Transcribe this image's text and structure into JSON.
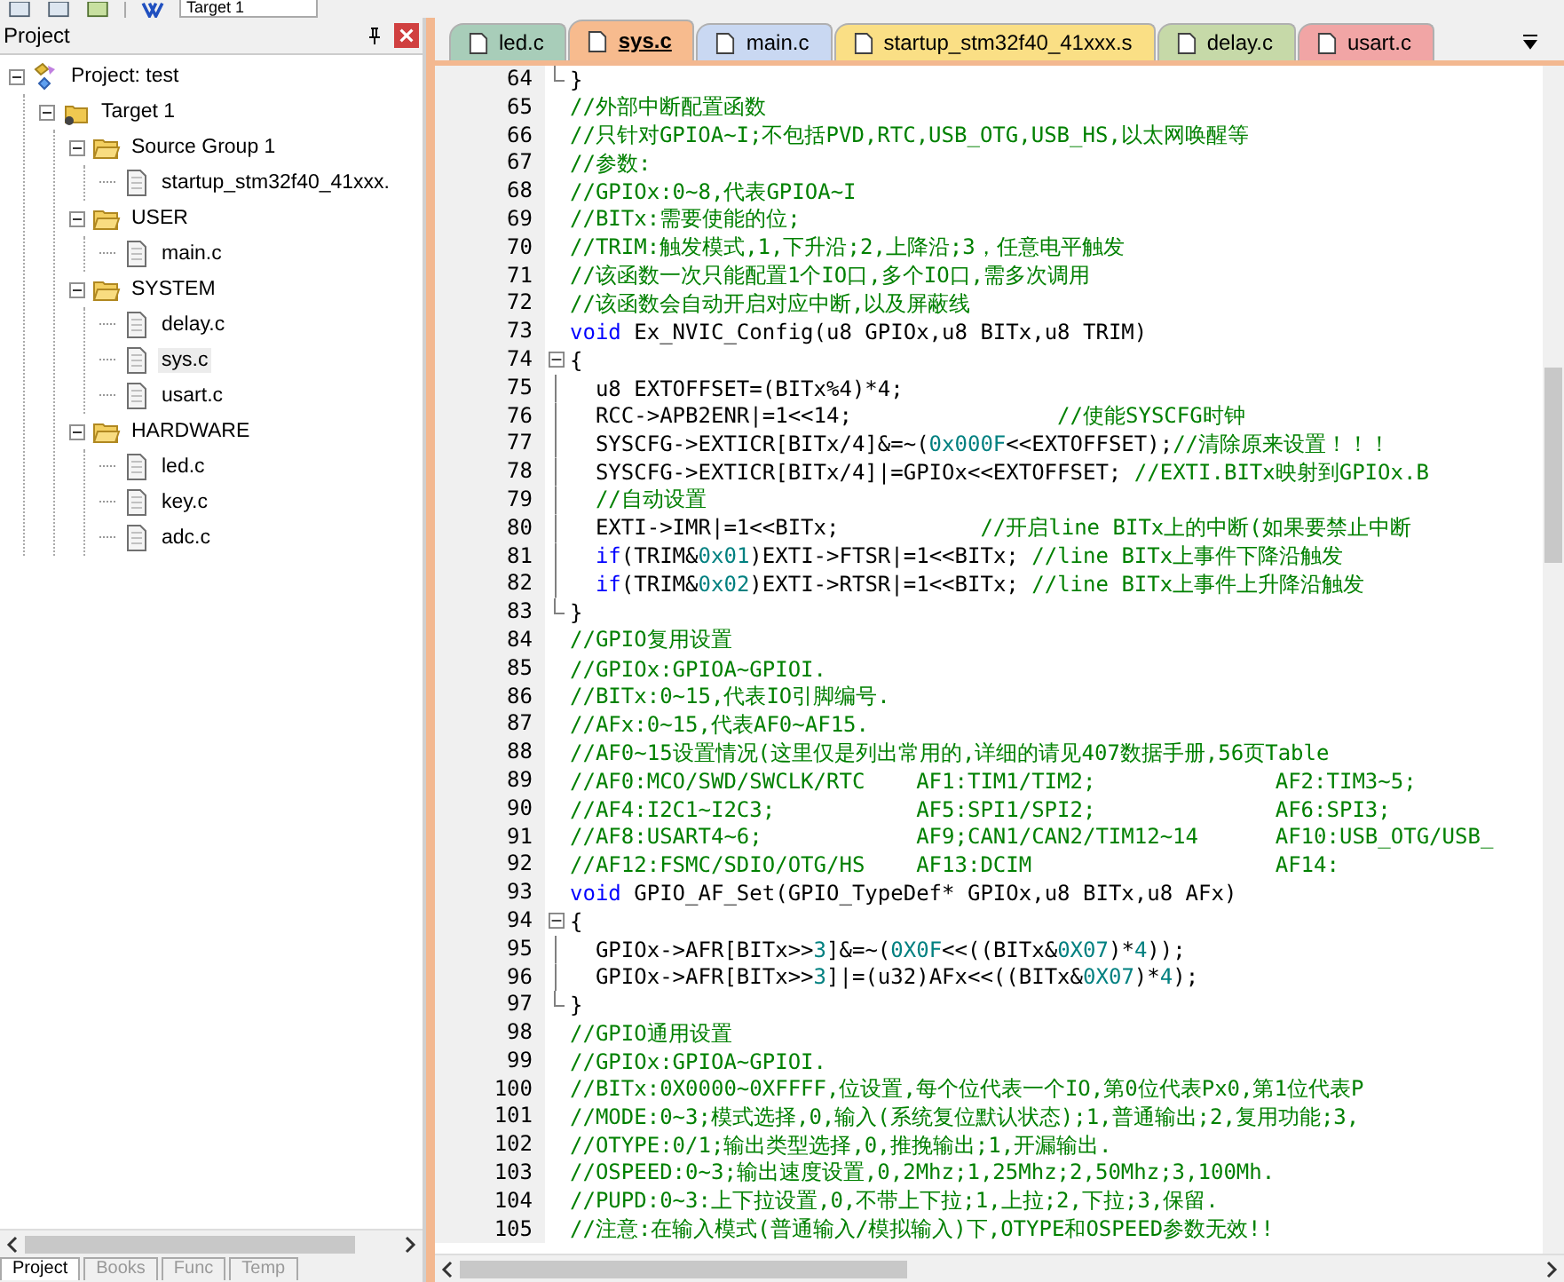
{
  "toolbar": {
    "target": "Target 1"
  },
  "project_panel": {
    "title": "Project",
    "tree": [
      {
        "label": "Project: test",
        "kind": "project",
        "expanded": true,
        "selected": false,
        "children": [
          {
            "label": "Target 1",
            "kind": "target",
            "expanded": true,
            "selected": false,
            "children": [
              {
                "label": "Source Group 1",
                "kind": "group",
                "expanded": true,
                "selected": false,
                "children": [
                  {
                    "label": "startup_stm32f40_41xxx.",
                    "kind": "file",
                    "selected": false
                  }
                ]
              },
              {
                "label": "USER",
                "kind": "group",
                "expanded": true,
                "selected": false,
                "children": [
                  {
                    "label": "main.c",
                    "kind": "file",
                    "selected": false
                  }
                ]
              },
              {
                "label": "SYSTEM",
                "kind": "group",
                "expanded": true,
                "selected": false,
                "children": [
                  {
                    "label": "delay.c",
                    "kind": "file",
                    "selected": false
                  },
                  {
                    "label": "sys.c",
                    "kind": "file",
                    "selected": true
                  },
                  {
                    "label": "usart.c",
                    "kind": "file",
                    "selected": false
                  }
                ]
              },
              {
                "label": "HARDWARE",
                "kind": "group",
                "expanded": true,
                "selected": false,
                "children": [
                  {
                    "label": "led.c",
                    "kind": "file",
                    "selected": false
                  },
                  {
                    "label": "key.c",
                    "kind": "file",
                    "selected": false
                  },
                  {
                    "label": "adc.c",
                    "kind": "file",
                    "selected": false
                  }
                ]
              }
            ]
          }
        ]
      }
    ],
    "bottom_tabs": [
      {
        "label": "Project",
        "selected": true
      },
      {
        "label": "Books",
        "selected": false
      },
      {
        "label": "Func",
        "selected": false
      },
      {
        "label": "Temp",
        "selected": false
      }
    ]
  },
  "editor_tabs": [
    {
      "label": "led.c",
      "selected": false,
      "color": "#a8cdb9"
    },
    {
      "label": "sys.c",
      "selected": true,
      "color": "#f7bb8e"
    },
    {
      "label": "main.c",
      "selected": false,
      "color": "#c9d8f2"
    },
    {
      "label": "startup_stm32f40_41xxx.s",
      "selected": false,
      "color": "#fadf85"
    },
    {
      "label": "delay.c",
      "selected": false,
      "color": "#c6d9a8"
    },
    {
      "label": "usart.c",
      "selected": false,
      "color": "#f1a5a5"
    }
  ],
  "code_lines": [
    {
      "number": "64",
      "fold_end": true,
      "segments": [
        {
          "kind": "plain",
          "text": "}"
        }
      ]
    },
    {
      "number": "65",
      "segments": [
        {
          "kind": "comment",
          "text": "//外部中断配置函数"
        }
      ]
    },
    {
      "number": "66",
      "segments": [
        {
          "kind": "comment",
          "text": "//只针对GPIOA~I;不包括PVD,RTC,USB_OTG,USB_HS,以太网唤醒等"
        }
      ]
    },
    {
      "number": "67",
      "segments": [
        {
          "kind": "comment",
          "text": "//参数:"
        }
      ]
    },
    {
      "number": "68",
      "segments": [
        {
          "kind": "comment",
          "text": "//GPIOx:0~8,代表GPIOA~I"
        }
      ]
    },
    {
      "number": "69",
      "segments": [
        {
          "kind": "comment",
          "text": "//BITx:需要使能的位;"
        }
      ]
    },
    {
      "number": "70",
      "segments": [
        {
          "kind": "comment",
          "text": "//TRIM:触发模式,1,下升沿;2,上降沿;3，任意电平触发"
        }
      ]
    },
    {
      "number": "71",
      "segments": [
        {
          "kind": "comment",
          "text": "//该函数一次只能配置1个IO口,多个IO口,需多次调用"
        }
      ]
    },
    {
      "number": "72",
      "segments": [
        {
          "kind": "comment",
          "text": "//该函数会自动开启对应中断,以及屏蔽线"
        }
      ]
    },
    {
      "number": "73",
      "segments": [
        {
          "kind": "keyword",
          "text": "void"
        },
        {
          "kind": "plain",
          "text": " Ex_NVIC_Config(u8 GPIOx,u8 BITx,u8 TRIM)"
        }
      ]
    },
    {
      "number": "74",
      "fold_start": true,
      "segments": [
        {
          "kind": "plain",
          "text": "{"
        }
      ]
    },
    {
      "number": "75",
      "fold_body": true,
      "segments": [
        {
          "kind": "plain",
          "text": "  u8 EXTOFFSET=(BITx%4)*4;"
        }
      ]
    },
    {
      "number": "76",
      "fold_body": true,
      "segments": [
        {
          "kind": "plain",
          "text": "  RCC->APB2ENR|=1<<14;                "
        },
        {
          "kind": "comment",
          "text": "//使能SYSCFG时钟"
        }
      ]
    },
    {
      "number": "77",
      "fold_body": true,
      "segments": [
        {
          "kind": "plain",
          "text": "  SYSCFG->EXTICR[BITx/4]&=~("
        },
        {
          "kind": "number",
          "text": "0x000F"
        },
        {
          "kind": "plain",
          "text": "<<EXTOFFSET);"
        },
        {
          "kind": "comment",
          "text": "//清除原来设置！！！"
        }
      ]
    },
    {
      "number": "78",
      "fold_body": true,
      "segments": [
        {
          "kind": "plain",
          "text": "  SYSCFG->EXTICR[BITx/4]|=GPIOx<<EXTOFFSET; "
        },
        {
          "kind": "comment",
          "text": "//EXTI.BITx映射到GPIOx.B"
        }
      ]
    },
    {
      "number": "79",
      "fold_body": true,
      "segments": [
        {
          "kind": "comment",
          "text": "  //自动设置"
        }
      ]
    },
    {
      "number": "80",
      "fold_body": true,
      "segments": [
        {
          "kind": "plain",
          "text": "  EXTI->IMR|=1<<BITx;           "
        },
        {
          "kind": "comment",
          "text": "//开启line BITx上的中断(如果要禁止中断"
        }
      ]
    },
    {
      "number": "81",
      "fold_body": true,
      "segments": [
        {
          "kind": "keyword",
          "text": "  if"
        },
        {
          "kind": "plain",
          "text": "(TRIM&"
        },
        {
          "kind": "number",
          "text": "0x01"
        },
        {
          "kind": "plain",
          "text": ")EXTI->FTSR|=1<<BITx; "
        },
        {
          "kind": "comment",
          "text": "//line BITx上事件下降沿触发"
        }
      ]
    },
    {
      "number": "82",
      "fold_body": true,
      "segments": [
        {
          "kind": "keyword",
          "text": "  if"
        },
        {
          "kind": "plain",
          "text": "(TRIM&"
        },
        {
          "kind": "number",
          "text": "0x02"
        },
        {
          "kind": "plain",
          "text": ")EXTI->RTSR|=1<<BITx; "
        },
        {
          "kind": "comment",
          "text": "//line BITx上事件上升降沿触发"
        }
      ]
    },
    {
      "number": "83",
      "fold_end": true,
      "segments": [
        {
          "kind": "plain",
          "text": "}"
        }
      ]
    },
    {
      "number": "84",
      "segments": [
        {
          "kind": "comment",
          "text": "//GPIO复用设置"
        }
      ]
    },
    {
      "number": "85",
      "segments": [
        {
          "kind": "comment",
          "text": "//GPIOx:GPIOA~GPIOI."
        }
      ]
    },
    {
      "number": "86",
      "segments": [
        {
          "kind": "comment",
          "text": "//BITx:0~15,代表IO引脚编号."
        }
      ]
    },
    {
      "number": "87",
      "segments": [
        {
          "kind": "comment",
          "text": "//AFx:0~15,代表AF0~AF15."
        }
      ]
    },
    {
      "number": "88",
      "segments": [
        {
          "kind": "comment",
          "text": "//AF0~15设置情况(这里仅是列出常用的,详细的请见407数据手册,56页Table"
        }
      ]
    },
    {
      "number": "89",
      "segments": [
        {
          "kind": "comment",
          "text": "//AF0:MCO/SWD/SWCLK/RTC    AF1:TIM1/TIM2;              AF2:TIM3~5;"
        }
      ]
    },
    {
      "number": "90",
      "segments": [
        {
          "kind": "comment",
          "text": "//AF4:I2C1~I2C3;           AF5:SPI1/SPI2;              AF6:SPI3;"
        }
      ]
    },
    {
      "number": "91",
      "segments": [
        {
          "kind": "comment",
          "text": "//AF8:USART4~6;            AF9;CAN1/CAN2/TIM12~14      AF10:USB_OTG/USB_"
        }
      ]
    },
    {
      "number": "92",
      "segments": [
        {
          "kind": "comment",
          "text": "//AF12:FSMC/SDIO/OTG/HS    AF13:DCIM                   AF14:"
        }
      ]
    },
    {
      "number": "93",
      "segments": [
        {
          "kind": "keyword",
          "text": "void"
        },
        {
          "kind": "plain",
          "text": " GPIO_AF_Set(GPIO_TypeDef* GPIOx,u8 BITx,u8 AFx)"
        }
      ]
    },
    {
      "number": "94",
      "fold_start": true,
      "segments": [
        {
          "kind": "plain",
          "text": "{"
        }
      ]
    },
    {
      "number": "95",
      "fold_body": true,
      "segments": [
        {
          "kind": "plain",
          "text": "  GPIOx->AFR[BITx>>"
        },
        {
          "kind": "number",
          "text": "3"
        },
        {
          "kind": "plain",
          "text": "]&=~("
        },
        {
          "kind": "number",
          "text": "0X0F"
        },
        {
          "kind": "plain",
          "text": "<<((BITx&"
        },
        {
          "kind": "number",
          "text": "0X07"
        },
        {
          "kind": "plain",
          "text": ")*"
        },
        {
          "kind": "number",
          "text": "4"
        },
        {
          "kind": "plain",
          "text": "));"
        }
      ]
    },
    {
      "number": "96",
      "fold_body": true,
      "segments": [
        {
          "kind": "plain",
          "text": "  GPIOx->AFR[BITx>>"
        },
        {
          "kind": "number",
          "text": "3"
        },
        {
          "kind": "plain",
          "text": "]|=(u32)AFx<<((BITx&"
        },
        {
          "kind": "number",
          "text": "0X07"
        },
        {
          "kind": "plain",
          "text": ")*"
        },
        {
          "kind": "number",
          "text": "4"
        },
        {
          "kind": "plain",
          "text": ");"
        }
      ]
    },
    {
      "number": "97",
      "fold_end": true,
      "segments": [
        {
          "kind": "plain",
          "text": "}"
        }
      ]
    },
    {
      "number": "98",
      "segments": [
        {
          "kind": "comment",
          "text": "//GPIO通用设置"
        }
      ]
    },
    {
      "number": "99",
      "segments": [
        {
          "kind": "comment",
          "text": "//GPIOx:GPIOA~GPIOI."
        }
      ]
    },
    {
      "number": "100",
      "segments": [
        {
          "kind": "comment",
          "text": "//BITx:0X0000~0XFFFF,位设置,每个位代表一个IO,第0位代表Px0,第1位代表P"
        }
      ]
    },
    {
      "number": "101",
      "segments": [
        {
          "kind": "comment",
          "text": "//MODE:0~3;模式选择,0,输入(系统复位默认状态);1,普通输出;2,复用功能;3,"
        }
      ]
    },
    {
      "number": "102",
      "segments": [
        {
          "kind": "comment",
          "text": "//OTYPE:0/1;输出类型选择,0,推挽输出;1,开漏输出."
        }
      ]
    },
    {
      "number": "103",
      "segments": [
        {
          "kind": "comment",
          "text": "//OSPEED:0~3;输出速度设置,0,2Mhz;1,25Mhz;2,50Mhz;3,100Mh."
        }
      ]
    },
    {
      "number": "104",
      "segments": [
        {
          "kind": "comment",
          "text": "//PUPD:0~3:上下拉设置,0,不带上下拉;1,上拉;2,下拉;3,保留."
        }
      ]
    },
    {
      "number": "105",
      "segments": [
        {
          "kind": "comment",
          "text": "//注意:在输入模式(普通输入/模拟输入)下,OTYPE和OSPEED参数无效!!"
        }
      ]
    }
  ]
}
